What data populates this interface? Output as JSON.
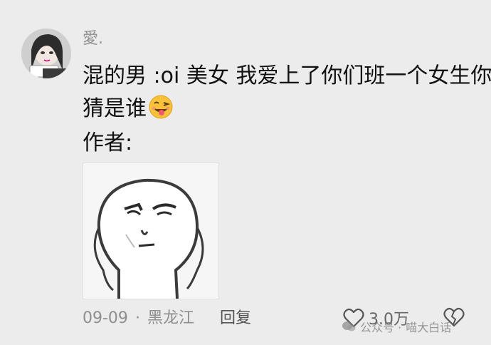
{
  "comment": {
    "username": "愛.",
    "text_line1": "混的男 :oi 美女 我爱上了你们班一个女生你",
    "text_line2": "猜是谁",
    "author_label": "作者:",
    "emoji": "tongue-wink-emoji",
    "sticker": "staring-meme-face-sticker",
    "meta": {
      "date": "09-09",
      "separator": "·",
      "location": "黑龙江",
      "reply_label": "回复"
    },
    "likes": "3.0万"
  },
  "watermark": {
    "platform": "公众号 ·",
    "account": "喵大白话"
  },
  "colors": {
    "background": "#ececec",
    "meta_text": "#8e8e8e"
  }
}
